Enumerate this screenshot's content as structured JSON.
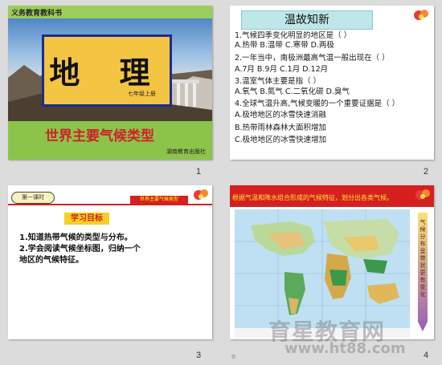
{
  "slides": [
    {
      "number": "1",
      "series": "义务教育教科书",
      "title": "地  理",
      "grade": "七年级上册",
      "subtitle": "世界主要气候类型",
      "publisher": "湖南教育出版社"
    },
    {
      "number": "2",
      "header": "温故知新",
      "lines": [
        "1.气候四季变化明显的地区是（ ）",
        "  A.热带  B.温带  C.寒带  D.两极",
        "2.一年当中，南极洲最高气温一般出现在（ ）",
        "  A.7月  B.9月  C.1月  D.12月",
        "3.温室气体主要是指（ ）",
        "  A.氧气 B.氮气 C.二氧化碳 D.臭气",
        "4.全球气温升高,气候变暖的一个重要证据是（ ）",
        "  A.极地地区的冰雪快速消融",
        "  B.热带雨林森林大面积增加",
        "  C.极地地区的冰雪快速增加"
      ]
    },
    {
      "number": "3",
      "lesson": "第一课时",
      "tag": "世界主要气候类型",
      "goal": "学习目标",
      "objectives": [
        "1.知道热带气候的类型与分布。",
        "2.学会阅读气候坐标图，归纳一个",
        "地区的气候特征。"
      ]
    },
    {
      "number": "4",
      "banner": "根据气温和降水组合形成的气候特征，划分出各类气候。",
      "side_label": "气候分布呈带状更有变化"
    }
  ],
  "watermark": {
    "brand": "育星教育网",
    "url": "www.ht88.com"
  },
  "colors": {
    "accent_red": "#d62020",
    "title_yellow": "#f4c542",
    "green": "#8cc44a"
  }
}
